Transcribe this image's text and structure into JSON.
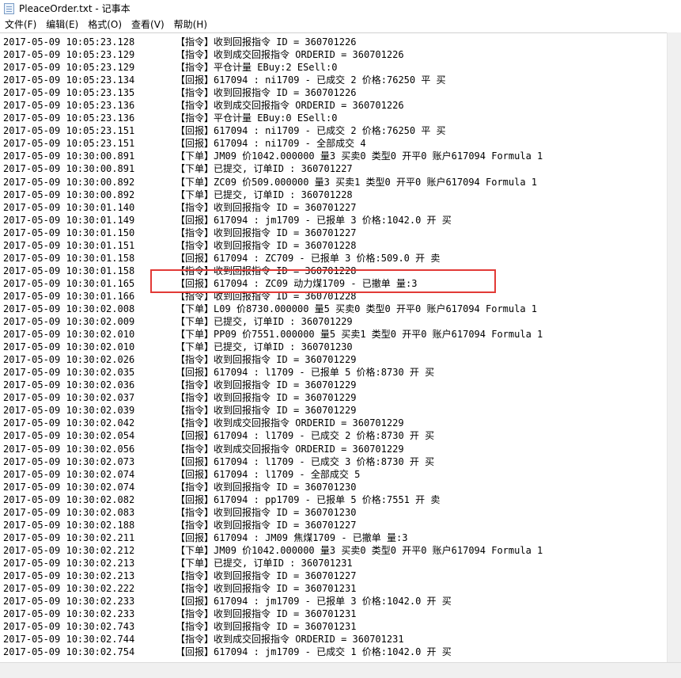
{
  "window": {
    "title": "PleaceOrder.txt - 记事本",
    "icon": "notepad-icon"
  },
  "menubar": {
    "items": [
      "文件(F)",
      "编辑(E)",
      "格式(O)",
      "查看(V)",
      "帮助(H)"
    ]
  },
  "log": [
    {
      "ts": "2017-05-09 10:05:23.128",
      "tag": "指令",
      "text": "收到回报指令 ID = 360701226"
    },
    {
      "ts": "2017-05-09 10:05:23.129",
      "tag": "指令",
      "text": "收到成交回报指令 ORDERID = 360701226"
    },
    {
      "ts": "2017-05-09 10:05:23.129",
      "tag": "指令",
      "text": "平仓计量 EBuy:2 ESell:0"
    },
    {
      "ts": "2017-05-09 10:05:23.134",
      "tag": "回报",
      "text": "617094 : ni1709 - 已成交 2 价格:76250 平 买"
    },
    {
      "ts": "2017-05-09 10:05:23.135",
      "tag": "指令",
      "text": "收到回报指令 ID = 360701226"
    },
    {
      "ts": "2017-05-09 10:05:23.136",
      "tag": "指令",
      "text": "收到成交回报指令 ORDERID = 360701226"
    },
    {
      "ts": "2017-05-09 10:05:23.136",
      "tag": "指令",
      "text": "平仓计量 EBuy:0 ESell:0"
    },
    {
      "ts": "2017-05-09 10:05:23.151",
      "tag": "回报",
      "text": "617094 : ni1709 - 已成交 2 价格:76250 平 买"
    },
    {
      "ts": "2017-05-09 10:05:23.151",
      "tag": "回报",
      "text": "617094 : ni1709 - 全部成交 4"
    },
    {
      "ts": "2017-05-09 10:30:00.891",
      "tag": "下单",
      "text": "JM09 价1042.000000 量3 买卖0 类型0 开平0 账户617094 Formula 1"
    },
    {
      "ts": "2017-05-09 10:30:00.891",
      "tag": "下单",
      "text": "已提交, 订单ID : 360701227"
    },
    {
      "ts": "2017-05-09 10:30:00.892",
      "tag": "下单",
      "text": "ZC09 价509.000000 量3 买卖1 类型0 开平0 账户617094 Formula 1"
    },
    {
      "ts": "2017-05-09 10:30:00.892",
      "tag": "下单",
      "text": "已提交, 订单ID : 360701228"
    },
    {
      "ts": "2017-05-09 10:30:01.140",
      "tag": "指令",
      "text": "收到回报指令 ID = 360701227"
    },
    {
      "ts": "2017-05-09 10:30:01.149",
      "tag": "回报",
      "text": "617094 : jm1709 - 已报单 3 价格:1042.0 开 买"
    },
    {
      "ts": "2017-05-09 10:30:01.150",
      "tag": "指令",
      "text": "收到回报指令 ID = 360701227"
    },
    {
      "ts": "2017-05-09 10:30:01.151",
      "tag": "指令",
      "text": "收到回报指令 ID = 360701228"
    },
    {
      "ts": "2017-05-09 10:30:01.158",
      "tag": "回报",
      "text": "617094 : ZC709 - 已报单 3 价格:509.0 开 卖"
    },
    {
      "ts": "2017-05-09 10:30:01.158",
      "tag": "指令",
      "text": "收到回报指令 ID = 360701228"
    },
    {
      "ts": "2017-05-09 10:30:01.165",
      "tag": "回报",
      "text": "617094 : ZC09 动力煤1709 - 已撤单 量:3"
    },
    {
      "ts": "2017-05-09 10:30:01.166",
      "tag": "指令",
      "text": "收到回报指令 ID = 360701228"
    },
    {
      "ts": "2017-05-09 10:30:02.008",
      "tag": "下单",
      "text": "L09 价8730.000000 量5 买卖0 类型0 开平0 账户617094 Formula 1"
    },
    {
      "ts": "2017-05-09 10:30:02.009",
      "tag": "下单",
      "text": "已提交, 订单ID : 360701229"
    },
    {
      "ts": "2017-05-09 10:30:02.010",
      "tag": "下单",
      "text": "PP09 价7551.000000 量5 买卖1 类型0 开平0 账户617094 Formula 1"
    },
    {
      "ts": "2017-05-09 10:30:02.010",
      "tag": "下单",
      "text": "已提交, 订单ID : 360701230"
    },
    {
      "ts": "2017-05-09 10:30:02.026",
      "tag": "指令",
      "text": "收到回报指令 ID = 360701229"
    },
    {
      "ts": "2017-05-09 10:30:02.035",
      "tag": "回报",
      "text": "617094 : l1709 - 已报单 5 价格:8730 开 买"
    },
    {
      "ts": "2017-05-09 10:30:02.036",
      "tag": "指令",
      "text": "收到回报指令 ID = 360701229"
    },
    {
      "ts": "2017-05-09 10:30:02.037",
      "tag": "指令",
      "text": "收到回报指令 ID = 360701229"
    },
    {
      "ts": "2017-05-09 10:30:02.039",
      "tag": "指令",
      "text": "收到回报指令 ID = 360701229"
    },
    {
      "ts": "2017-05-09 10:30:02.042",
      "tag": "指令",
      "text": "收到成交回报指令 ORDERID = 360701229"
    },
    {
      "ts": "2017-05-09 10:30:02.054",
      "tag": "回报",
      "text": "617094 : l1709 - 已成交 2 价格:8730 开 买"
    },
    {
      "ts": "2017-05-09 10:30:02.056",
      "tag": "指令",
      "text": "收到成交回报指令 ORDERID = 360701229"
    },
    {
      "ts": "2017-05-09 10:30:02.073",
      "tag": "回报",
      "text": "617094 : l1709 - 已成交 3 价格:8730 开 买"
    },
    {
      "ts": "2017-05-09 10:30:02.074",
      "tag": "回报",
      "text": "617094 : l1709 - 全部成交 5"
    },
    {
      "ts": "2017-05-09 10:30:02.074",
      "tag": "指令",
      "text": "收到回报指令 ID = 360701230"
    },
    {
      "ts": "2017-05-09 10:30:02.082",
      "tag": "回报",
      "text": "617094 : pp1709 - 已报单 5 价格:7551 开 卖"
    },
    {
      "ts": "2017-05-09 10:30:02.083",
      "tag": "指令",
      "text": "收到回报指令 ID = 360701230"
    },
    {
      "ts": "2017-05-09 10:30:02.188",
      "tag": "指令",
      "text": "收到回报指令 ID = 360701227"
    },
    {
      "ts": "2017-05-09 10:30:02.211",
      "tag": "回报",
      "text": "617094 : JM09 焦煤1709 - 已撤单 量:3"
    },
    {
      "ts": "2017-05-09 10:30:02.212",
      "tag": "下单",
      "text": "JM09 价1042.000000 量3 买卖0 类型0 开平0 账户617094 Formula 1"
    },
    {
      "ts": "2017-05-09 10:30:02.213",
      "tag": "下单",
      "text": "已提交, 订单ID : 360701231"
    },
    {
      "ts": "2017-05-09 10:30:02.213",
      "tag": "指令",
      "text": "收到回报指令 ID = 360701227"
    },
    {
      "ts": "2017-05-09 10:30:02.222",
      "tag": "指令",
      "text": "收到回报指令 ID = 360701231"
    },
    {
      "ts": "2017-05-09 10:30:02.233",
      "tag": "回报",
      "text": "617094 : jm1709 - 已报单 3 价格:1042.0 开 买"
    },
    {
      "ts": "2017-05-09 10:30:02.233",
      "tag": "指令",
      "text": "收到回报指令 ID = 360701231"
    },
    {
      "ts": "2017-05-09 10:30:02.743",
      "tag": "指令",
      "text": "收到回报指令 ID = 360701231"
    },
    {
      "ts": "2017-05-09 10:30:02.744",
      "tag": "指令",
      "text": "收到成交回报指令 ORDERID = 360701231"
    },
    {
      "ts": "2017-05-09 10:30:02.754",
      "tag": "回报",
      "text": "617094 : jm1709 - 已成交 1 价格:1042.0 开 买"
    }
  ],
  "highlight": {
    "color": "#e23a36"
  }
}
